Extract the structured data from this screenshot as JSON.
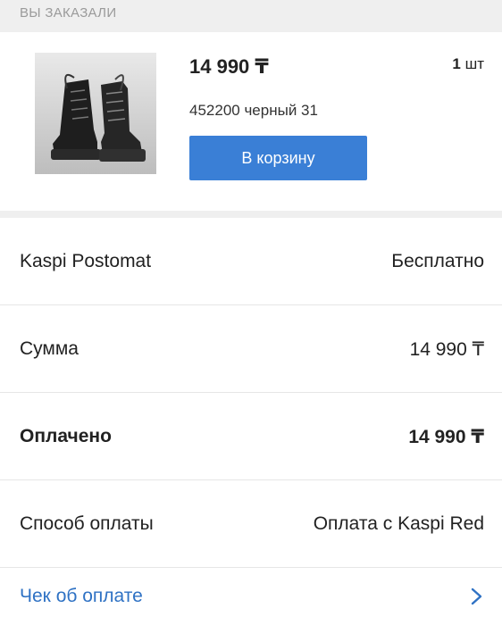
{
  "section": {
    "title": "ВЫ ЗАКАЗАЛИ"
  },
  "order_item": {
    "price": "14 990 ₸",
    "quantity_value": "1",
    "quantity_unit": "шт",
    "variant": "452200 черный 31",
    "cart_button_label": "В корзину",
    "image_alt": "boots-photo"
  },
  "summary": {
    "rows": [
      {
        "label": "Kaspi Postomat",
        "value": "Бесплатно"
      },
      {
        "label": "Сумма",
        "value": "14 990 ₸"
      },
      {
        "label": "Оплачено",
        "value": "14 990 ₸"
      },
      {
        "label": "Способ оплаты",
        "value": "Оплата с Kaspi Red"
      }
    ],
    "receipt_link": "Чек об оплате"
  },
  "colors": {
    "accent": "#3a7fd6",
    "link": "#2f72c4",
    "header_bg": "#efefef"
  }
}
